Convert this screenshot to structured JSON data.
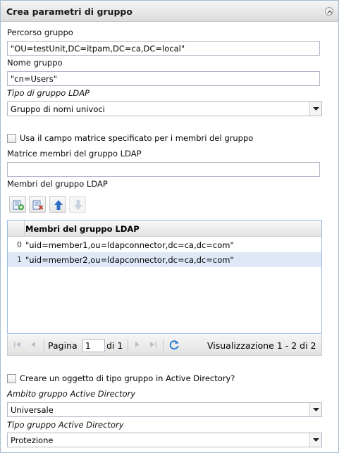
{
  "panel": {
    "title": "Crea parametri di gruppo",
    "collapse_icon": "chevron-up-icon"
  },
  "group_path": {
    "label": "Percorso gruppo",
    "value": "\"OU=testUnit,DC=itpam,DC=ca,DC=local\""
  },
  "group_name": {
    "label": "Nome gruppo",
    "value": "\"cn=Users\""
  },
  "ldap_group_type": {
    "label": "Tipo di gruppo LDAP",
    "selected": "Gruppo di nomi univoci"
  },
  "use_matrix_field": {
    "label": "Usa il campo matrice specificato per i membri del gruppo",
    "checked": false
  },
  "ldap_member_matrix": {
    "label": "Matrice membri del gruppo LDAP",
    "value": ""
  },
  "ldap_members": {
    "label": "Membri del gruppo LDAP",
    "toolbar": {
      "add_icon": "add-row-icon",
      "delete_icon": "delete-row-icon",
      "move_up_icon": "arrow-up-icon",
      "move_down_icon": "arrow-down-icon"
    },
    "column_header": "Membri del gruppo LDAP",
    "rows": [
      {
        "index": "0",
        "value": "\"uid=member1,ou=ldapconnector,dc=ca,dc=com\""
      },
      {
        "index": "1",
        "value": "\"uid=member2,ou=ldapconnector,dc=ca,dc=com\""
      }
    ]
  },
  "pager": {
    "page_label": "Pagina",
    "page_value": "1",
    "of_label": "di 1",
    "summary": "Visualizzazione 1 - 2 di 2"
  },
  "create_ad_group": {
    "label": "Creare un oggetto di tipo gruppo in Active Directory?",
    "checked": false
  },
  "ad_group_scope": {
    "label": "Ambito gruppo Active Directory",
    "selected": "Universale"
  },
  "ad_group_type": {
    "label": "Tipo gruppo Active Directory",
    "selected": "Protezione"
  },
  "colors": {
    "accent": "#99bbe8",
    "selected_row": "#dfe8f6",
    "border": "#b5b8c8"
  }
}
